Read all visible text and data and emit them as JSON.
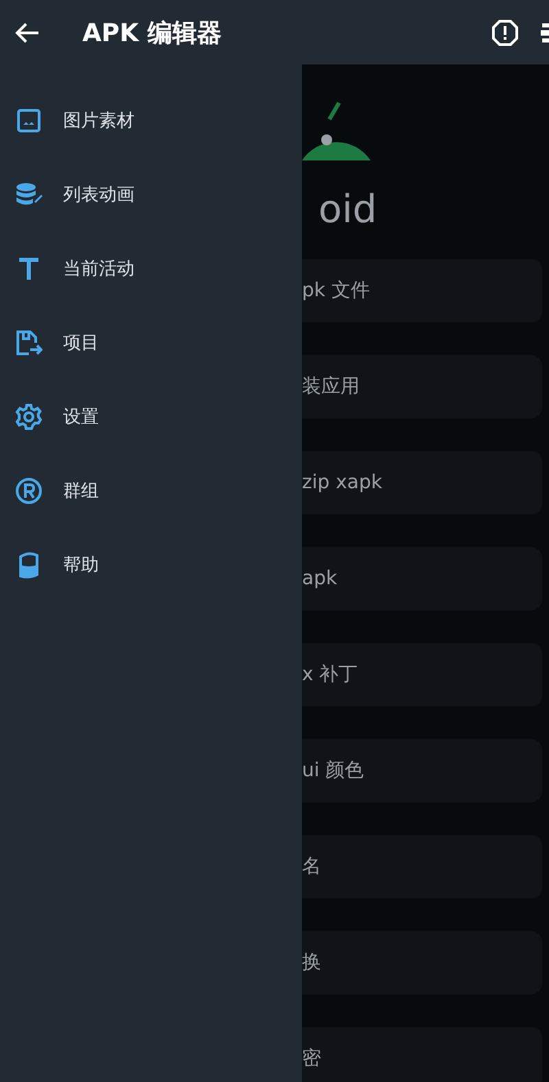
{
  "app_bar": {
    "title": "APK 编辑器"
  },
  "drawer": {
    "items": [
      {
        "label": "图片素材",
        "kind": "image"
      },
      {
        "label": "列表动画",
        "kind": "database"
      },
      {
        "label": "当前活动",
        "kind": "text"
      },
      {
        "label": "项目",
        "kind": "file"
      },
      {
        "label": "设置",
        "kind": "gear"
      },
      {
        "label": "群组",
        "kind": "registered"
      },
      {
        "label": "帮助",
        "kind": "cup"
      }
    ]
  },
  "main": {
    "logo_text": "oid",
    "cards": [
      {
        "label": "pk 文件"
      },
      {
        "label": "装应用"
      },
      {
        "label": "zip xapk"
      },
      {
        "label": "apk"
      },
      {
        "label": "x 补丁"
      },
      {
        "label": "ui 颜色"
      },
      {
        "label": "名"
      },
      {
        "label": "换"
      },
      {
        "label": "密"
      }
    ]
  }
}
